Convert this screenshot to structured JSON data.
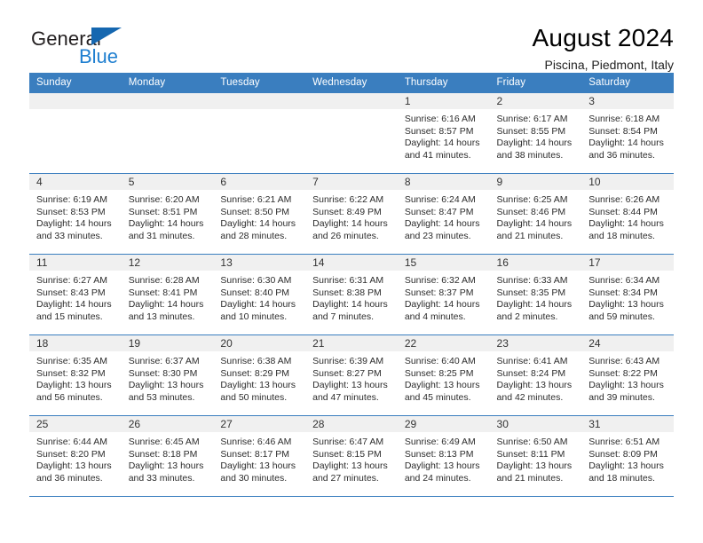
{
  "brand": {
    "name_part1": "General",
    "name_part2": "Blue",
    "flag_icon": "triangle-flag-icon"
  },
  "header": {
    "title": "August 2024",
    "location": "Piscina, Piedmont, Italy"
  },
  "weekday_headers": [
    "Sunday",
    "Monday",
    "Tuesday",
    "Wednesday",
    "Thursday",
    "Friday",
    "Saturday"
  ],
  "colors": {
    "header_blue": "#3a7ebf",
    "brand_blue": "#1f7fd0",
    "daynum_background": "#f0f0f0"
  },
  "weeks": [
    [
      {
        "day": "",
        "empty": true,
        "sunrise": "",
        "sunset": "",
        "daylight_line1": "",
        "daylight_line2": ""
      },
      {
        "day": "",
        "empty": true,
        "sunrise": "",
        "sunset": "",
        "daylight_line1": "",
        "daylight_line2": ""
      },
      {
        "day": "",
        "empty": true,
        "sunrise": "",
        "sunset": "",
        "daylight_line1": "",
        "daylight_line2": ""
      },
      {
        "day": "",
        "empty": true,
        "sunrise": "",
        "sunset": "",
        "daylight_line1": "",
        "daylight_line2": ""
      },
      {
        "day": "1",
        "empty": false,
        "sunrise": "Sunrise: 6:16 AM",
        "sunset": "Sunset: 8:57 PM",
        "daylight_line1": "Daylight: 14 hours",
        "daylight_line2": "and 41 minutes."
      },
      {
        "day": "2",
        "empty": false,
        "sunrise": "Sunrise: 6:17 AM",
        "sunset": "Sunset: 8:55 PM",
        "daylight_line1": "Daylight: 14 hours",
        "daylight_line2": "and 38 minutes."
      },
      {
        "day": "3",
        "empty": false,
        "sunrise": "Sunrise: 6:18 AM",
        "sunset": "Sunset: 8:54 PM",
        "daylight_line1": "Daylight: 14 hours",
        "daylight_line2": "and 36 minutes."
      }
    ],
    [
      {
        "day": "4",
        "empty": false,
        "sunrise": "Sunrise: 6:19 AM",
        "sunset": "Sunset: 8:53 PM",
        "daylight_line1": "Daylight: 14 hours",
        "daylight_line2": "and 33 minutes."
      },
      {
        "day": "5",
        "empty": false,
        "sunrise": "Sunrise: 6:20 AM",
        "sunset": "Sunset: 8:51 PM",
        "daylight_line1": "Daylight: 14 hours",
        "daylight_line2": "and 31 minutes."
      },
      {
        "day": "6",
        "empty": false,
        "sunrise": "Sunrise: 6:21 AM",
        "sunset": "Sunset: 8:50 PM",
        "daylight_line1": "Daylight: 14 hours",
        "daylight_line2": "and 28 minutes."
      },
      {
        "day": "7",
        "empty": false,
        "sunrise": "Sunrise: 6:22 AM",
        "sunset": "Sunset: 8:49 PM",
        "daylight_line1": "Daylight: 14 hours",
        "daylight_line2": "and 26 minutes."
      },
      {
        "day": "8",
        "empty": false,
        "sunrise": "Sunrise: 6:24 AM",
        "sunset": "Sunset: 8:47 PM",
        "daylight_line1": "Daylight: 14 hours",
        "daylight_line2": "and 23 minutes."
      },
      {
        "day": "9",
        "empty": false,
        "sunrise": "Sunrise: 6:25 AM",
        "sunset": "Sunset: 8:46 PM",
        "daylight_line1": "Daylight: 14 hours",
        "daylight_line2": "and 21 minutes."
      },
      {
        "day": "10",
        "empty": false,
        "sunrise": "Sunrise: 6:26 AM",
        "sunset": "Sunset: 8:44 PM",
        "daylight_line1": "Daylight: 14 hours",
        "daylight_line2": "and 18 minutes."
      }
    ],
    [
      {
        "day": "11",
        "empty": false,
        "sunrise": "Sunrise: 6:27 AM",
        "sunset": "Sunset: 8:43 PM",
        "daylight_line1": "Daylight: 14 hours",
        "daylight_line2": "and 15 minutes."
      },
      {
        "day": "12",
        "empty": false,
        "sunrise": "Sunrise: 6:28 AM",
        "sunset": "Sunset: 8:41 PM",
        "daylight_line1": "Daylight: 14 hours",
        "daylight_line2": "and 13 minutes."
      },
      {
        "day": "13",
        "empty": false,
        "sunrise": "Sunrise: 6:30 AM",
        "sunset": "Sunset: 8:40 PM",
        "daylight_line1": "Daylight: 14 hours",
        "daylight_line2": "and 10 minutes."
      },
      {
        "day": "14",
        "empty": false,
        "sunrise": "Sunrise: 6:31 AM",
        "sunset": "Sunset: 8:38 PM",
        "daylight_line1": "Daylight: 14 hours",
        "daylight_line2": "and 7 minutes."
      },
      {
        "day": "15",
        "empty": false,
        "sunrise": "Sunrise: 6:32 AM",
        "sunset": "Sunset: 8:37 PM",
        "daylight_line1": "Daylight: 14 hours",
        "daylight_line2": "and 4 minutes."
      },
      {
        "day": "16",
        "empty": false,
        "sunrise": "Sunrise: 6:33 AM",
        "sunset": "Sunset: 8:35 PM",
        "daylight_line1": "Daylight: 14 hours",
        "daylight_line2": "and 2 minutes."
      },
      {
        "day": "17",
        "empty": false,
        "sunrise": "Sunrise: 6:34 AM",
        "sunset": "Sunset: 8:34 PM",
        "daylight_line1": "Daylight: 13 hours",
        "daylight_line2": "and 59 minutes."
      }
    ],
    [
      {
        "day": "18",
        "empty": false,
        "sunrise": "Sunrise: 6:35 AM",
        "sunset": "Sunset: 8:32 PM",
        "daylight_line1": "Daylight: 13 hours",
        "daylight_line2": "and 56 minutes."
      },
      {
        "day": "19",
        "empty": false,
        "sunrise": "Sunrise: 6:37 AM",
        "sunset": "Sunset: 8:30 PM",
        "daylight_line1": "Daylight: 13 hours",
        "daylight_line2": "and 53 minutes."
      },
      {
        "day": "20",
        "empty": false,
        "sunrise": "Sunrise: 6:38 AM",
        "sunset": "Sunset: 8:29 PM",
        "daylight_line1": "Daylight: 13 hours",
        "daylight_line2": "and 50 minutes."
      },
      {
        "day": "21",
        "empty": false,
        "sunrise": "Sunrise: 6:39 AM",
        "sunset": "Sunset: 8:27 PM",
        "daylight_line1": "Daylight: 13 hours",
        "daylight_line2": "and 47 minutes."
      },
      {
        "day": "22",
        "empty": false,
        "sunrise": "Sunrise: 6:40 AM",
        "sunset": "Sunset: 8:25 PM",
        "daylight_line1": "Daylight: 13 hours",
        "daylight_line2": "and 45 minutes."
      },
      {
        "day": "23",
        "empty": false,
        "sunrise": "Sunrise: 6:41 AM",
        "sunset": "Sunset: 8:24 PM",
        "daylight_line1": "Daylight: 13 hours",
        "daylight_line2": "and 42 minutes."
      },
      {
        "day": "24",
        "empty": false,
        "sunrise": "Sunrise: 6:43 AM",
        "sunset": "Sunset: 8:22 PM",
        "daylight_line1": "Daylight: 13 hours",
        "daylight_line2": "and 39 minutes."
      }
    ],
    [
      {
        "day": "25",
        "empty": false,
        "sunrise": "Sunrise: 6:44 AM",
        "sunset": "Sunset: 8:20 PM",
        "daylight_line1": "Daylight: 13 hours",
        "daylight_line2": "and 36 minutes."
      },
      {
        "day": "26",
        "empty": false,
        "sunrise": "Sunrise: 6:45 AM",
        "sunset": "Sunset: 8:18 PM",
        "daylight_line1": "Daylight: 13 hours",
        "daylight_line2": "and 33 minutes."
      },
      {
        "day": "27",
        "empty": false,
        "sunrise": "Sunrise: 6:46 AM",
        "sunset": "Sunset: 8:17 PM",
        "daylight_line1": "Daylight: 13 hours",
        "daylight_line2": "and 30 minutes."
      },
      {
        "day": "28",
        "empty": false,
        "sunrise": "Sunrise: 6:47 AM",
        "sunset": "Sunset: 8:15 PM",
        "daylight_line1": "Daylight: 13 hours",
        "daylight_line2": "and 27 minutes."
      },
      {
        "day": "29",
        "empty": false,
        "sunrise": "Sunrise: 6:49 AM",
        "sunset": "Sunset: 8:13 PM",
        "daylight_line1": "Daylight: 13 hours",
        "daylight_line2": "and 24 minutes."
      },
      {
        "day": "30",
        "empty": false,
        "sunrise": "Sunrise: 6:50 AM",
        "sunset": "Sunset: 8:11 PM",
        "daylight_line1": "Daylight: 13 hours",
        "daylight_line2": "and 21 minutes."
      },
      {
        "day": "31",
        "empty": false,
        "sunrise": "Sunrise: 6:51 AM",
        "sunset": "Sunset: 8:09 PM",
        "daylight_line1": "Daylight: 13 hours",
        "daylight_line2": "and 18 minutes."
      }
    ]
  ]
}
